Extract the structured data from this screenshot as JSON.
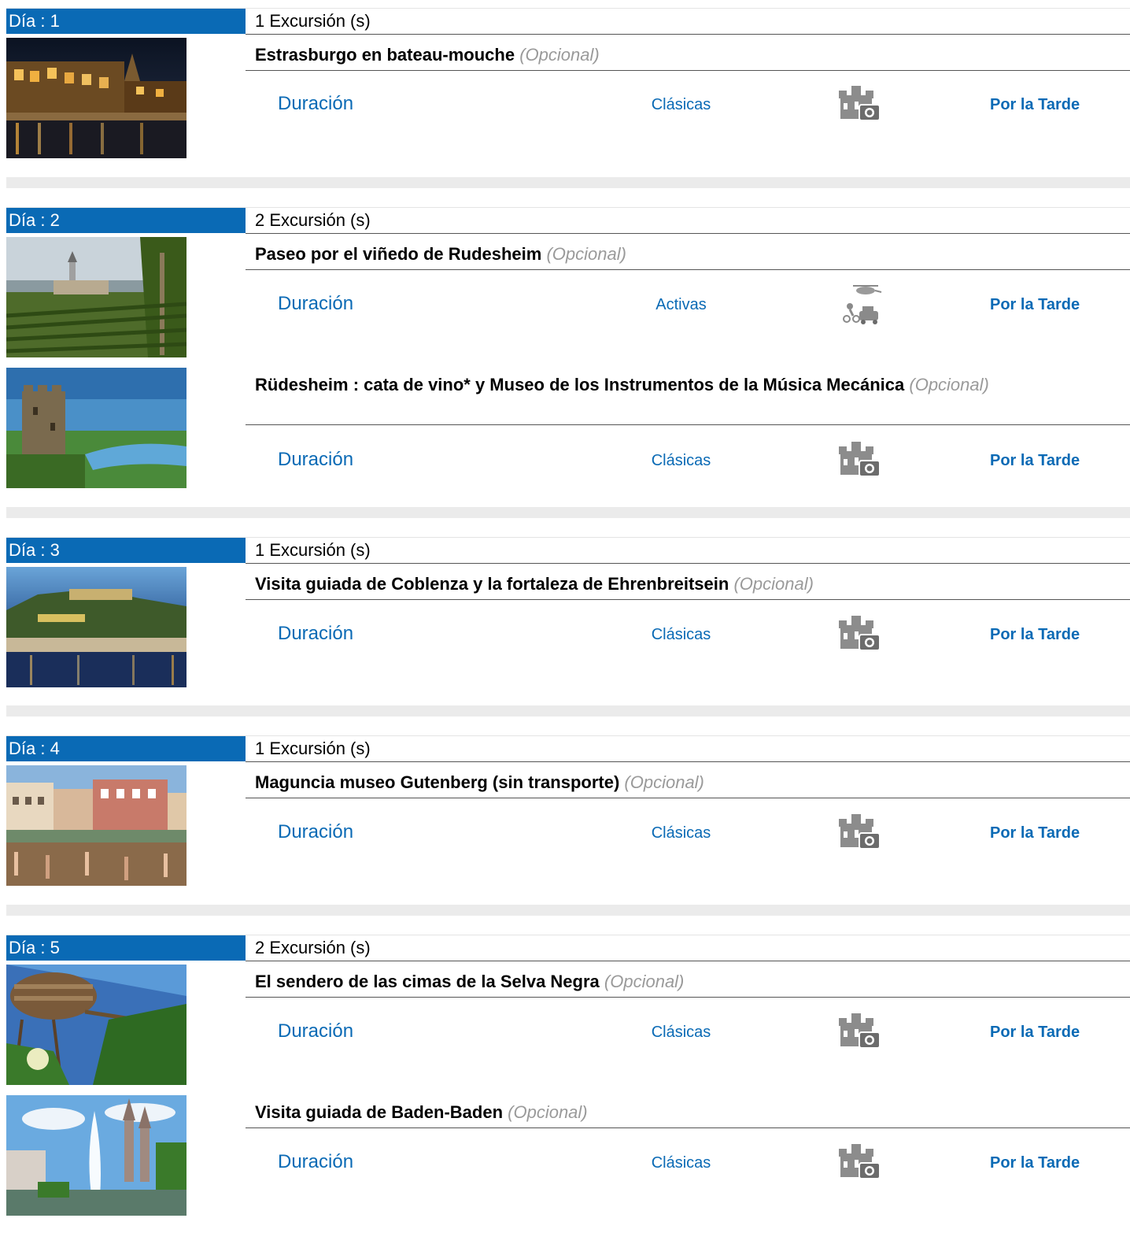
{
  "days": [
    {
      "label": "Día : 1",
      "count": "1 Excursión (s)",
      "excursions": [
        {
          "title": "Estrasburgo en bateau-mouche",
          "optional": "(Opcional)",
          "duration_label": "Duración",
          "category": "Clásicas",
          "category_icon": "castle-camera-icon",
          "time": "Por la Tarde",
          "image": "strasbourg-night-canal"
        }
      ]
    },
    {
      "label": "Día : 2",
      "count": "2 Excursión (s)",
      "excursions": [
        {
          "title": "Paseo por el viñedo de Rudesheim",
          "optional": "(Opcional)",
          "duration_label": "Duración",
          "category": "Activas",
          "category_icon": "active-transport-icon",
          "time": "Por la Tarde",
          "image": "rudesheim-vineyard"
        },
        {
          "title": "Rüdesheim : cata de vino* y Museo de los Instrumentos de la Música Mecánica",
          "optional": "(Opcional)",
          "duration_label": "Duración",
          "category": "Clásicas",
          "category_icon": "castle-camera-icon",
          "time": "Por la Tarde",
          "image": "rhine-castle-tower"
        }
      ]
    },
    {
      "label": "Día : 3",
      "count": "1 Excursión (s)",
      "excursions": [
        {
          "title": "Visita guiada de Coblenza y la fortaleza de Ehrenbreitsein",
          "optional": "(Opcional)",
          "duration_label": "Duración",
          "category": "Clásicas",
          "category_icon": "castle-camera-icon",
          "time": "Por la Tarde",
          "image": "koblenz-fortress-dusk"
        }
      ]
    },
    {
      "label": "Día : 4",
      "count": "1 Excursión (s)",
      "excursions": [
        {
          "title": "Maguncia museo Gutenberg (sin transporte)",
          "optional": "(Opcional)",
          "duration_label": "Duración",
          "category": "Clásicas",
          "category_icon": "castle-camera-icon",
          "time": "Por la Tarde",
          "image": "mainz-market-square"
        }
      ]
    },
    {
      "label": "Día : 5",
      "count": "2 Excursión (s)",
      "excursions": [
        {
          "title": "El sendero de las cimas de la Selva Negra",
          "optional": "(Opcional)",
          "duration_label": "Duración",
          "category": "Clásicas",
          "category_icon": "castle-camera-icon",
          "time": "Por la Tarde",
          "image": "black-forest-treetop-walk"
        },
        {
          "title": "Visita guiada de Baden-Baden",
          "optional": "(Opcional)",
          "duration_label": "Duración",
          "category": "Clásicas",
          "category_icon": "castle-camera-icon",
          "time": "Por la Tarde",
          "image": "baden-baden-fountain"
        }
      ]
    }
  ],
  "colors": {
    "accent": "#0a6ab5",
    "optional_text": "#9a9a9a",
    "separator": "#ebebeb"
  }
}
